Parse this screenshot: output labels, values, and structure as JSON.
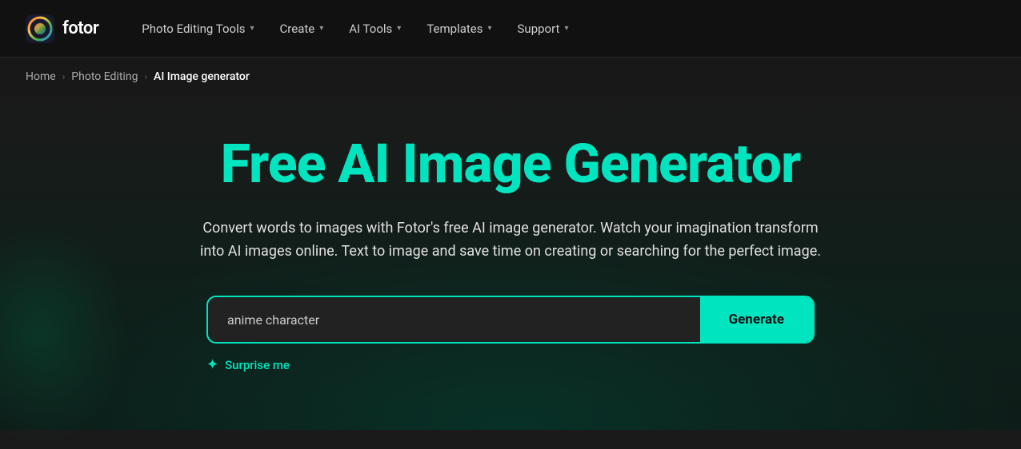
{
  "brand": {
    "name": "fotor",
    "logo_icon": "✦"
  },
  "nav": {
    "items": [
      {
        "id": "photo-editing-tools",
        "label": "Photo Editing Tools",
        "has_dropdown": true
      },
      {
        "id": "create",
        "label": "Create",
        "has_dropdown": true
      },
      {
        "id": "ai-tools",
        "label": "AI Tools",
        "has_dropdown": true
      },
      {
        "id": "templates",
        "label": "Templates",
        "has_dropdown": true
      },
      {
        "id": "support",
        "label": "Support",
        "has_dropdown": true
      }
    ]
  },
  "breadcrumb": {
    "items": [
      {
        "id": "home",
        "label": "Home",
        "active": false
      },
      {
        "id": "photo-editing",
        "label": "Photo Editing",
        "active": false
      },
      {
        "id": "ai-image-generator",
        "label": "AI Image generator",
        "active": true
      }
    ]
  },
  "hero": {
    "title": "Free AI Image Generator",
    "description": "Convert words to images with Fotor's free AI image generator. Watch your imagination transform into AI images online. Text to image and save time on creating or searching for the perfect image.",
    "search_placeholder": "anime character",
    "search_current_value": "anime character",
    "generate_button_label": "Generate",
    "surprise_label": "Surprise me"
  },
  "colors": {
    "accent": "#00e5c0",
    "background": "#1a1a1a",
    "nav_bg": "#111111"
  }
}
